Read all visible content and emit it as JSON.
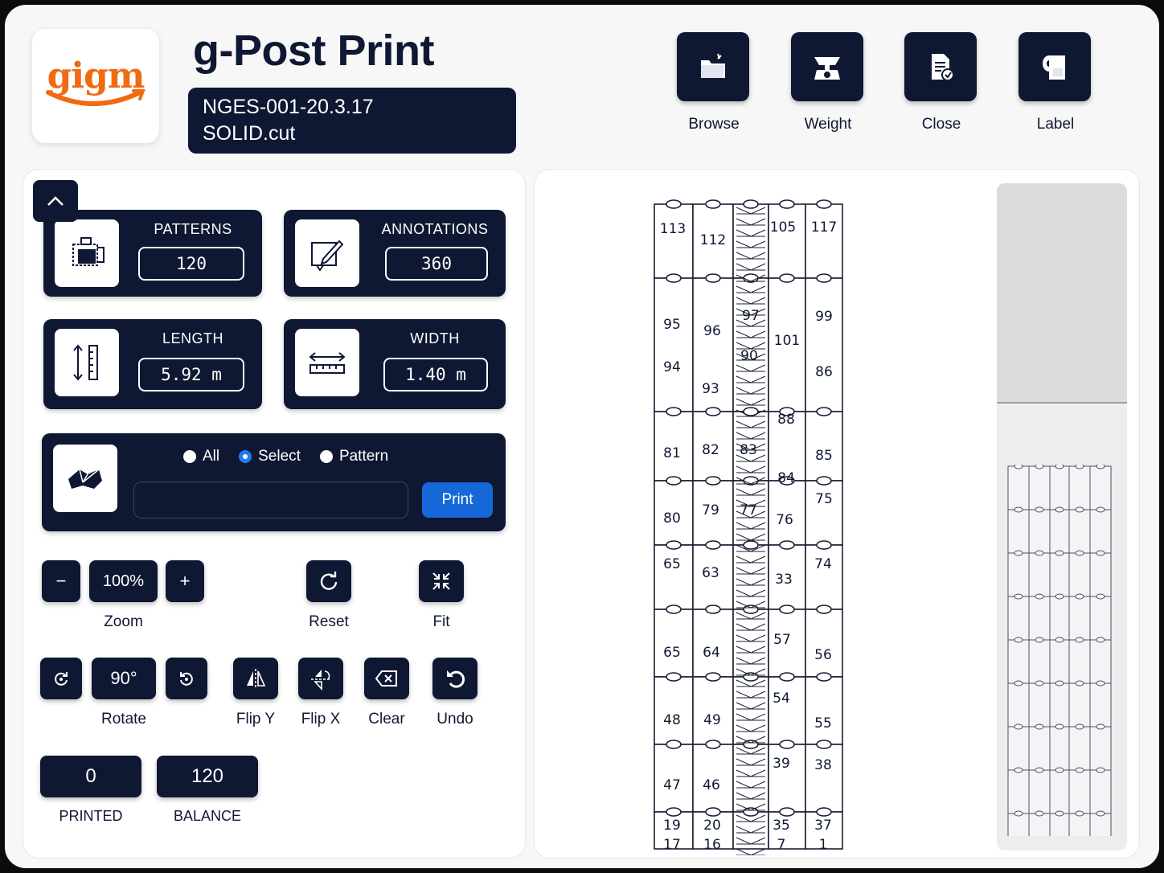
{
  "header": {
    "logo_text": "gigm",
    "title": "g-Post Print",
    "file_line1": "NGES-001-20.3.17",
    "file_line2": "SOLID.cut"
  },
  "toolbar": {
    "browse_label": "Browse",
    "weight_label": "Weight",
    "close_label": "Close",
    "label_label": "Label"
  },
  "stats": {
    "patterns": {
      "title": "PATTERNS",
      "value": "120"
    },
    "annotations": {
      "title": "ANNOTATIONS",
      "value": "360"
    },
    "length": {
      "title": "LENGTH",
      "value": "5.92 m"
    },
    "width": {
      "title": "WIDTH",
      "value": "1.40 m"
    }
  },
  "print_mode": {
    "options": [
      "All",
      "Select",
      "Pattern"
    ],
    "selected": "Select",
    "input_value": "",
    "print_label": "Print"
  },
  "zoom": {
    "minus": "−",
    "value": "100%",
    "plus": "+",
    "label": "Zoom"
  },
  "reset": {
    "label": "Reset"
  },
  "fit": {
    "label": "Fit"
  },
  "rotate": {
    "value": "90°",
    "label": "Rotate"
  },
  "actions": {
    "flip_y": "Flip Y",
    "flip_x": "Flip X",
    "clear": "Clear",
    "undo": "Undo"
  },
  "counters": {
    "printed": {
      "value": "0",
      "label": "PRINTED"
    },
    "balance": {
      "value": "120",
      "label": "BALANCE"
    }
  },
  "marker": {
    "piece_numbers": [
      "113",
      "112",
      "105",
      "117",
      "95",
      "96",
      "97",
      "101",
      "99",
      "94",
      "93",
      "90",
      "86",
      "88",
      "81",
      "82",
      "83",
      "84",
      "85",
      "80",
      "79",
      "77",
      "76",
      "75",
      "65",
      "63",
      "33",
      "74",
      "65",
      "64",
      "57",
      "56",
      "48",
      "49",
      "54",
      "55",
      "47",
      "46",
      "39",
      "38",
      "19",
      "20",
      "35",
      "37",
      "17",
      "16",
      "7",
      "1"
    ]
  },
  "colors": {
    "navy": "#0f1833",
    "accent_blue": "#1668d8",
    "logo_orange": "#f06a12"
  }
}
